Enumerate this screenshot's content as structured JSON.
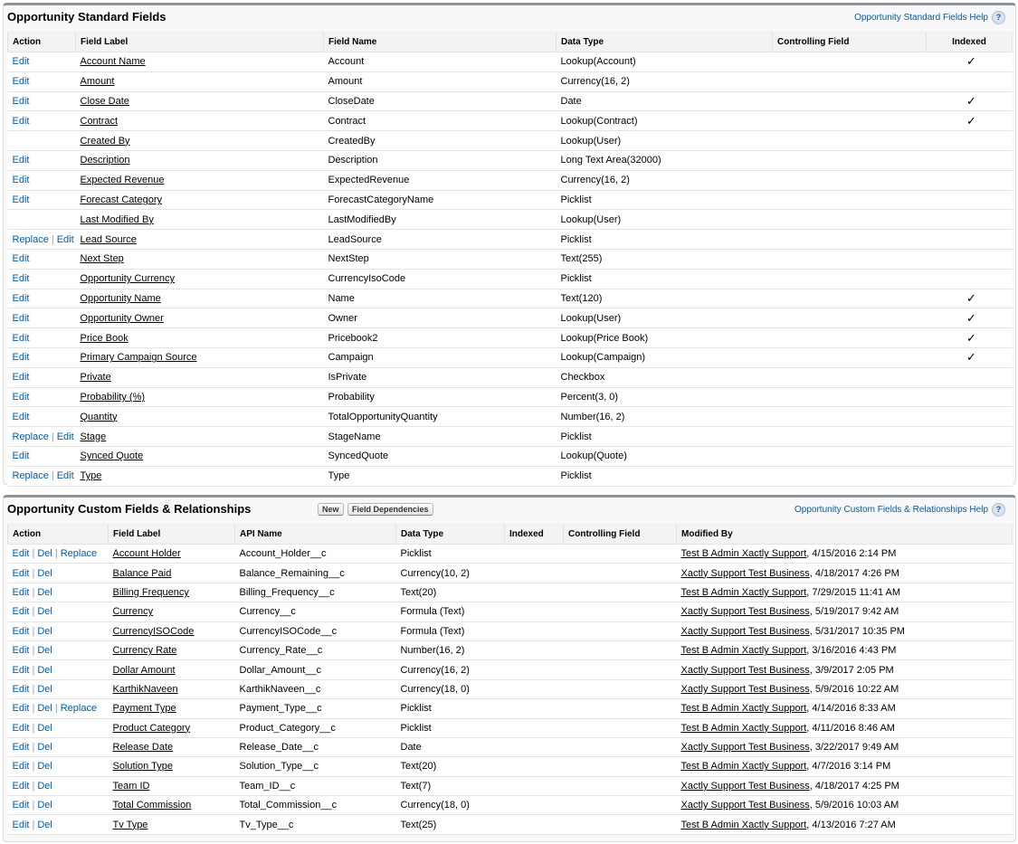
{
  "standard": {
    "title": "Opportunity Standard Fields",
    "help_link": "Opportunity Standard Fields Help",
    "help_icon": "?",
    "check_glyph": "✓",
    "columns": {
      "action": "Action",
      "field_label": "Field Label",
      "field_name": "Field Name",
      "data_type": "Data Type",
      "controlling_field": "Controlling Field",
      "indexed": "Indexed"
    },
    "rows": [
      {
        "actions": [
          "Edit"
        ],
        "label": "Account Name",
        "name": "Account",
        "type": "Lookup(Account)",
        "controlling": "",
        "indexed": true
      },
      {
        "actions": [
          "Edit"
        ],
        "label": "Amount",
        "name": "Amount",
        "type": "Currency(16, 2)",
        "controlling": "",
        "indexed": false
      },
      {
        "actions": [
          "Edit"
        ],
        "label": "Close Date",
        "name": "CloseDate",
        "type": "Date",
        "controlling": "",
        "indexed": true
      },
      {
        "actions": [
          "Edit"
        ],
        "label": "Contract",
        "name": "Contract",
        "type": "Lookup(Contract)",
        "controlling": "",
        "indexed": true
      },
      {
        "actions": [],
        "label": "Created By",
        "name": "CreatedBy",
        "type": "Lookup(User)",
        "controlling": "",
        "indexed": false
      },
      {
        "actions": [
          "Edit"
        ],
        "label": "Description",
        "name": "Description",
        "type": "Long Text Area(32000)",
        "controlling": "",
        "indexed": false
      },
      {
        "actions": [
          "Edit"
        ],
        "label": "Expected Revenue",
        "name": "ExpectedRevenue",
        "type": "Currency(16, 2)",
        "controlling": "",
        "indexed": false
      },
      {
        "actions": [
          "Edit"
        ],
        "label": "Forecast Category",
        "name": "ForecastCategoryName",
        "type": "Picklist",
        "controlling": "",
        "indexed": false
      },
      {
        "actions": [],
        "label": "Last Modified By",
        "name": "LastModifiedBy",
        "type": "Lookup(User)",
        "controlling": "",
        "indexed": false
      },
      {
        "actions": [
          "Replace",
          "Edit"
        ],
        "label": "Lead Source",
        "name": "LeadSource",
        "type": "Picklist",
        "controlling": "",
        "indexed": false
      },
      {
        "actions": [
          "Edit"
        ],
        "label": "Next Step",
        "name": "NextStep",
        "type": "Text(255)",
        "controlling": "",
        "indexed": false
      },
      {
        "actions": [
          "Edit"
        ],
        "label": "Opportunity Currency",
        "name": "CurrencyIsoCode",
        "type": "Picklist",
        "controlling": "",
        "indexed": false
      },
      {
        "actions": [
          "Edit"
        ],
        "label": "Opportunity Name",
        "name": "Name",
        "type": "Text(120)",
        "controlling": "",
        "indexed": true
      },
      {
        "actions": [
          "Edit"
        ],
        "label": "Opportunity Owner",
        "name": "Owner",
        "type": "Lookup(User)",
        "controlling": "",
        "indexed": true
      },
      {
        "actions": [
          "Edit"
        ],
        "label": "Price Book",
        "name": "Pricebook2",
        "type": "Lookup(Price Book)",
        "controlling": "",
        "indexed": true
      },
      {
        "actions": [
          "Edit"
        ],
        "label": "Primary Campaign Source",
        "name": "Campaign",
        "type": "Lookup(Campaign)",
        "controlling": "",
        "indexed": true
      },
      {
        "actions": [
          "Edit"
        ],
        "label": "Private",
        "name": "IsPrivate",
        "type": "Checkbox",
        "controlling": "",
        "indexed": false
      },
      {
        "actions": [
          "Edit"
        ],
        "label": "Probability (%)",
        "name": "Probability",
        "type": "Percent(3, 0)",
        "controlling": "",
        "indexed": false
      },
      {
        "actions": [
          "Edit"
        ],
        "label": "Quantity",
        "name": "TotalOpportunityQuantity",
        "type": "Number(16, 2)",
        "controlling": "",
        "indexed": false
      },
      {
        "actions": [
          "Replace",
          "Edit"
        ],
        "label": "Stage",
        "name": "StageName",
        "type": "Picklist",
        "controlling": "",
        "indexed": false
      },
      {
        "actions": [
          "Edit"
        ],
        "label": "Synced Quote",
        "name": "SyncedQuote",
        "type": "Lookup(Quote)",
        "controlling": "",
        "indexed": false
      },
      {
        "actions": [
          "Replace",
          "Edit"
        ],
        "label": "Type",
        "name": "Type",
        "type": "Picklist",
        "controlling": "",
        "indexed": false
      }
    ]
  },
  "custom": {
    "title": "Opportunity Custom Fields & Relationships",
    "new_button": "New",
    "dependencies_button": "Field Dependencies",
    "help_link": "Opportunity Custom Fields & Relationships Help",
    "help_icon": "?",
    "columns": {
      "action": "Action",
      "field_label": "Field Label",
      "api_name": "API Name",
      "data_type": "Data Type",
      "indexed": "Indexed",
      "controlling_field": "Controlling Field",
      "modified_by": "Modified By"
    },
    "rows": [
      {
        "actions": [
          "Edit",
          "Del",
          "Replace"
        ],
        "label": "Account Holder",
        "api": "Account_Holder__c",
        "type": "Picklist",
        "indexed": "",
        "controlling": "",
        "modified_by": "Test B Admin Xactly Support",
        "modified_at": ", 4/15/2016 2:14 PM"
      },
      {
        "actions": [
          "Edit",
          "Del"
        ],
        "label": "Balance Paid",
        "api": "Balance_Remaining__c",
        "type": "Currency(10, 2)",
        "indexed": "",
        "controlling": "",
        "modified_by": "Xactly Support Test Business",
        "modified_at": ", 4/18/2017 4:26 PM"
      },
      {
        "actions": [
          "Edit",
          "Del"
        ],
        "label": "Billing Frequency",
        "api": "Billing_Frequency__c",
        "type": "Text(20)",
        "indexed": "",
        "controlling": "",
        "modified_by": "Test B Admin Xactly Support",
        "modified_at": ", 7/29/2015 11:41 AM"
      },
      {
        "actions": [
          "Edit",
          "Del"
        ],
        "label": "Currency",
        "api": "Currency__c",
        "type": "Formula (Text)",
        "indexed": "",
        "controlling": "",
        "modified_by": "Xactly Support Test Business",
        "modified_at": ", 5/19/2017 9:42 AM"
      },
      {
        "actions": [
          "Edit",
          "Del"
        ],
        "label": "CurrencyISOCode",
        "api": "CurrencyISOCode__c",
        "type": "Formula (Text)",
        "indexed": "",
        "controlling": "",
        "modified_by": "Xactly Support Test Business",
        "modified_at": ", 5/31/2017 10:35 PM"
      },
      {
        "actions": [
          "Edit",
          "Del"
        ],
        "label": "Currency Rate",
        "api": "Currency_Rate__c",
        "type": "Number(16, 2)",
        "indexed": "",
        "controlling": "",
        "modified_by": "Test B Admin Xactly Support",
        "modified_at": ", 3/16/2016 4:43 PM"
      },
      {
        "actions": [
          "Edit",
          "Del"
        ],
        "label": "Dollar Amount",
        "api": "Dollar_Amount__c",
        "type": "Currency(16, 2)",
        "indexed": "",
        "controlling": "",
        "modified_by": "Xactly Support Test Business",
        "modified_at": ", 3/9/2017 2:05 PM"
      },
      {
        "actions": [
          "Edit",
          "Del"
        ],
        "label": "KarthikNaveen",
        "api": "KarthikNaveen__c",
        "type": "Currency(18, 0)",
        "indexed": "",
        "controlling": "",
        "modified_by": "Xactly Support Test Business",
        "modified_at": ", 5/9/2016 10:22 AM"
      },
      {
        "actions": [
          "Edit",
          "Del",
          "Replace"
        ],
        "label": "Payment Type",
        "api": "Payment_Type__c",
        "type": "Picklist",
        "indexed": "",
        "controlling": "",
        "modified_by": "Test B Admin Xactly Support",
        "modified_at": ", 4/14/2016 8:33 AM"
      },
      {
        "actions": [
          "Edit",
          "Del"
        ],
        "label": "Product Category",
        "api": "Product_Category__c",
        "type": "Picklist",
        "indexed": "",
        "controlling": "",
        "modified_by": "Test B Admin Xactly Support",
        "modified_at": ", 4/11/2016 8:46 AM"
      },
      {
        "actions": [
          "Edit",
          "Del"
        ],
        "label": "Release Date",
        "api": "Release_Date__c",
        "type": "Date",
        "indexed": "",
        "controlling": "",
        "modified_by": "Xactly Support Test Business",
        "modified_at": ", 3/22/2017 9:49 AM"
      },
      {
        "actions": [
          "Edit",
          "Del"
        ],
        "label": "Solution Type",
        "api": "Solution_Type__c",
        "type": "Text(20)",
        "indexed": "",
        "controlling": "",
        "modified_by": "Test B Admin Xactly Support",
        "modified_at": ", 4/7/2016 3:14 PM"
      },
      {
        "actions": [
          "Edit",
          "Del"
        ],
        "label": "Team ID",
        "api": "Team_ID__c",
        "type": "Text(7)",
        "indexed": "",
        "controlling": "",
        "modified_by": "Xactly Support Test Business",
        "modified_at": ", 4/18/2017 4:25 PM"
      },
      {
        "actions": [
          "Edit",
          "Del"
        ],
        "label": "Total Commission",
        "api": "Total_Commission__c",
        "type": "Currency(18, 0)",
        "indexed": "",
        "controlling": "",
        "modified_by": "Xactly Support Test Business",
        "modified_at": ", 5/9/2016 10:03 AM"
      },
      {
        "actions": [
          "Edit",
          "Del"
        ],
        "label": "Tv Type",
        "api": "Tv_Type__c",
        "type": "Text(25)",
        "indexed": "",
        "controlling": "",
        "modified_by": "Test B Admin Xactly Support",
        "modified_at": ", 4/13/2016 7:27 AM"
      }
    ]
  }
}
